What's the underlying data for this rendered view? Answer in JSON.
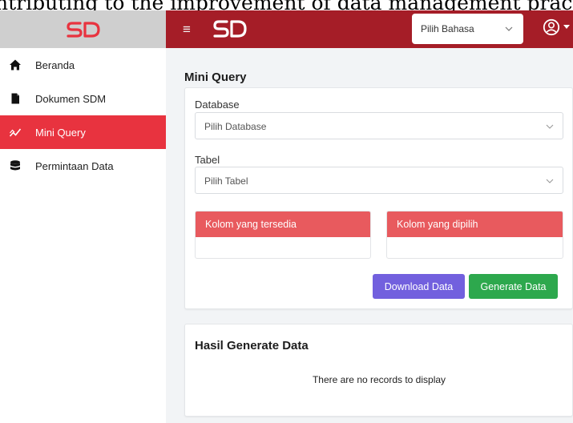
{
  "caption": "ntributing to the improvement of data management practices",
  "brand": {
    "logo_text": "SD"
  },
  "colors": {
    "topbar": "#a51d27",
    "brand_red": "#e8333f",
    "sidebar_header": "#cfcfcf",
    "panel_header": "#e85a5e",
    "download_button": "#7260de",
    "generate_button": "#2da84d"
  },
  "sidebar": {
    "items": [
      {
        "label": "Beranda",
        "icon": "home-icon",
        "active": false
      },
      {
        "label": "Dokumen SDM",
        "icon": "document-icon",
        "active": false
      },
      {
        "label": "Mini Query",
        "icon": "chart-line-icon",
        "active": true
      },
      {
        "label": "Permintaan Data",
        "icon": "database-icon",
        "active": false
      }
    ]
  },
  "topbar": {
    "menu_icon": "hamburger-icon",
    "language_select": {
      "value": "Pilih Bahasa"
    },
    "user_icon": "user-circle-icon"
  },
  "main": {
    "title": "Mini Query",
    "database": {
      "label": "Database",
      "placeholder": "Pilih Database"
    },
    "table": {
      "label": "Tabel",
      "placeholder": "Pilih Tabel"
    },
    "available_columns": {
      "title": "Kolom yang tersedia"
    },
    "selected_columns": {
      "title": "Kolom yang dipilih"
    },
    "buttons": {
      "download": "Download Data",
      "generate": "Generate Data"
    }
  },
  "results": {
    "title": "Hasil Generate Data",
    "empty_message": "There are no records to display"
  }
}
